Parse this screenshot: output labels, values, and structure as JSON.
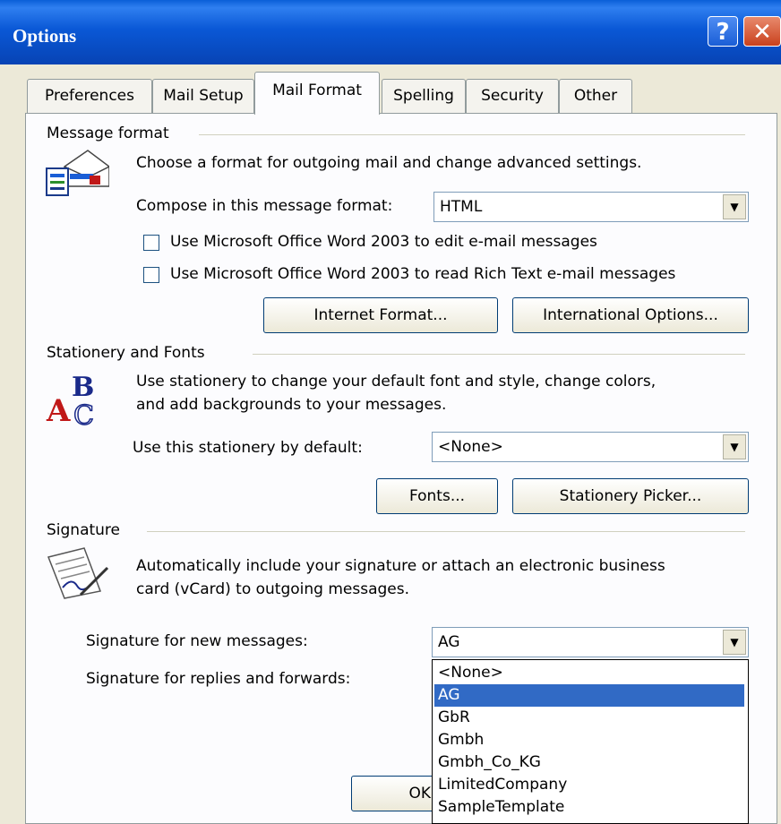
{
  "window": {
    "title": "Options",
    "help_glyph": "?",
    "close_glyph": "✕"
  },
  "tabs": [
    {
      "label": "Preferences"
    },
    {
      "label": "Mail Setup"
    },
    {
      "label": "Mail Format",
      "active": true
    },
    {
      "label": "Spelling"
    },
    {
      "label": "Security"
    },
    {
      "label": "Other"
    }
  ],
  "message_format": {
    "section_title": "Message format",
    "description": "Choose a format for outgoing mail and change advanced settings.",
    "compose_label": "Compose in this message format:",
    "compose_value": "HTML",
    "checkbox_edit": {
      "label": "Use Microsoft Office Word 2003 to edit e-mail messages",
      "checked": false
    },
    "checkbox_read": {
      "label": "Use Microsoft Office Word 2003 to read Rich Text e-mail messages",
      "checked": false
    },
    "internet_format_button": "Internet Format...",
    "international_options_button": "International Options..."
  },
  "stationery": {
    "section_title": "Stationery and Fonts",
    "description_line1": "Use stationery to change your default font and style, change colors,",
    "description_line2": "and add backgrounds to your messages.",
    "default_label": "Use this stationery by default:",
    "default_value": "<None>",
    "fonts_button": "Fonts...",
    "picker_button": "Stationery Picker..."
  },
  "signature": {
    "section_title": "Signature",
    "description_line1": "Automatically include your signature or attach an electronic business",
    "description_line2": "card (vCard) to outgoing messages.",
    "new_label": "Signature for new messages:",
    "new_value": "AG",
    "replies_label": "Signature for replies and forwards:",
    "dropdown_options": [
      "<None>",
      "AG",
      "GbR",
      "Gmbh",
      "Gmbh_Co_KG",
      "LimitedCompany",
      "SampleTemplate"
    ],
    "dropdown_selected": "AG"
  },
  "footer": {
    "ok_button": "OK"
  },
  "colors": {
    "titlebar": "#0a58d6",
    "selection": "#316ac5",
    "dialog_bg": "#ece9d8"
  }
}
